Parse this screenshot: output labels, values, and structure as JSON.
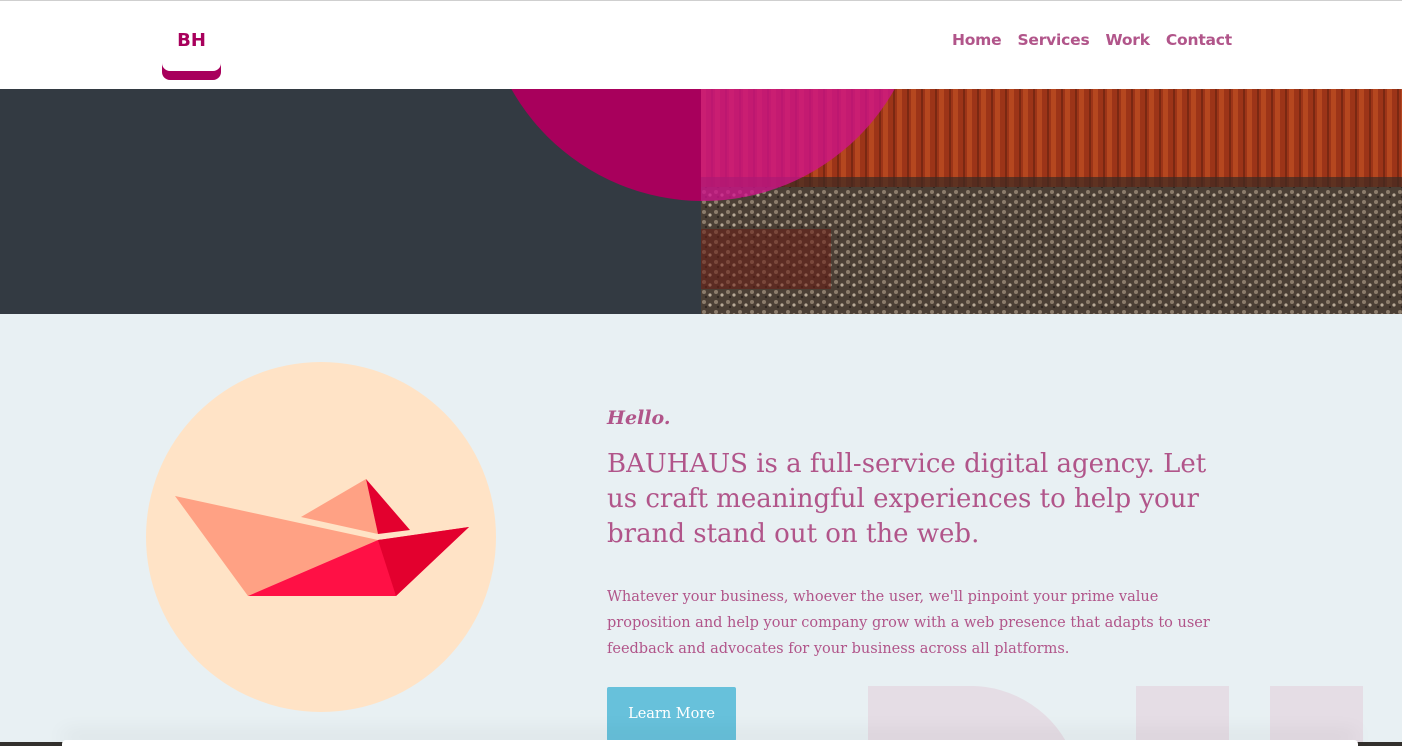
{
  "header": {
    "logo_text": "BH",
    "nav": [
      "Home",
      "Services",
      "Work",
      "Contact"
    ]
  },
  "intro": {
    "hello": "Hello.",
    "headline": "BAUHAUS is a full-service digital agency. Let us craft meaningful experiences to help your brand stand out on the web.",
    "body": "Whatever your business, whoever the user, we'll pinpoint your prime value proposition and help your company grow with a web presence that adapts to user feedback and advocates for your business across all platforms.",
    "button_label": "Learn More"
  },
  "colors": {
    "brand": "#a8005c",
    "text_accent": "#b1558a",
    "button": "#67c1db",
    "hero_dark": "#333a42",
    "section_bg": "#e8f0f3"
  },
  "icons": {
    "illustration": "paper-boat-illustration"
  }
}
